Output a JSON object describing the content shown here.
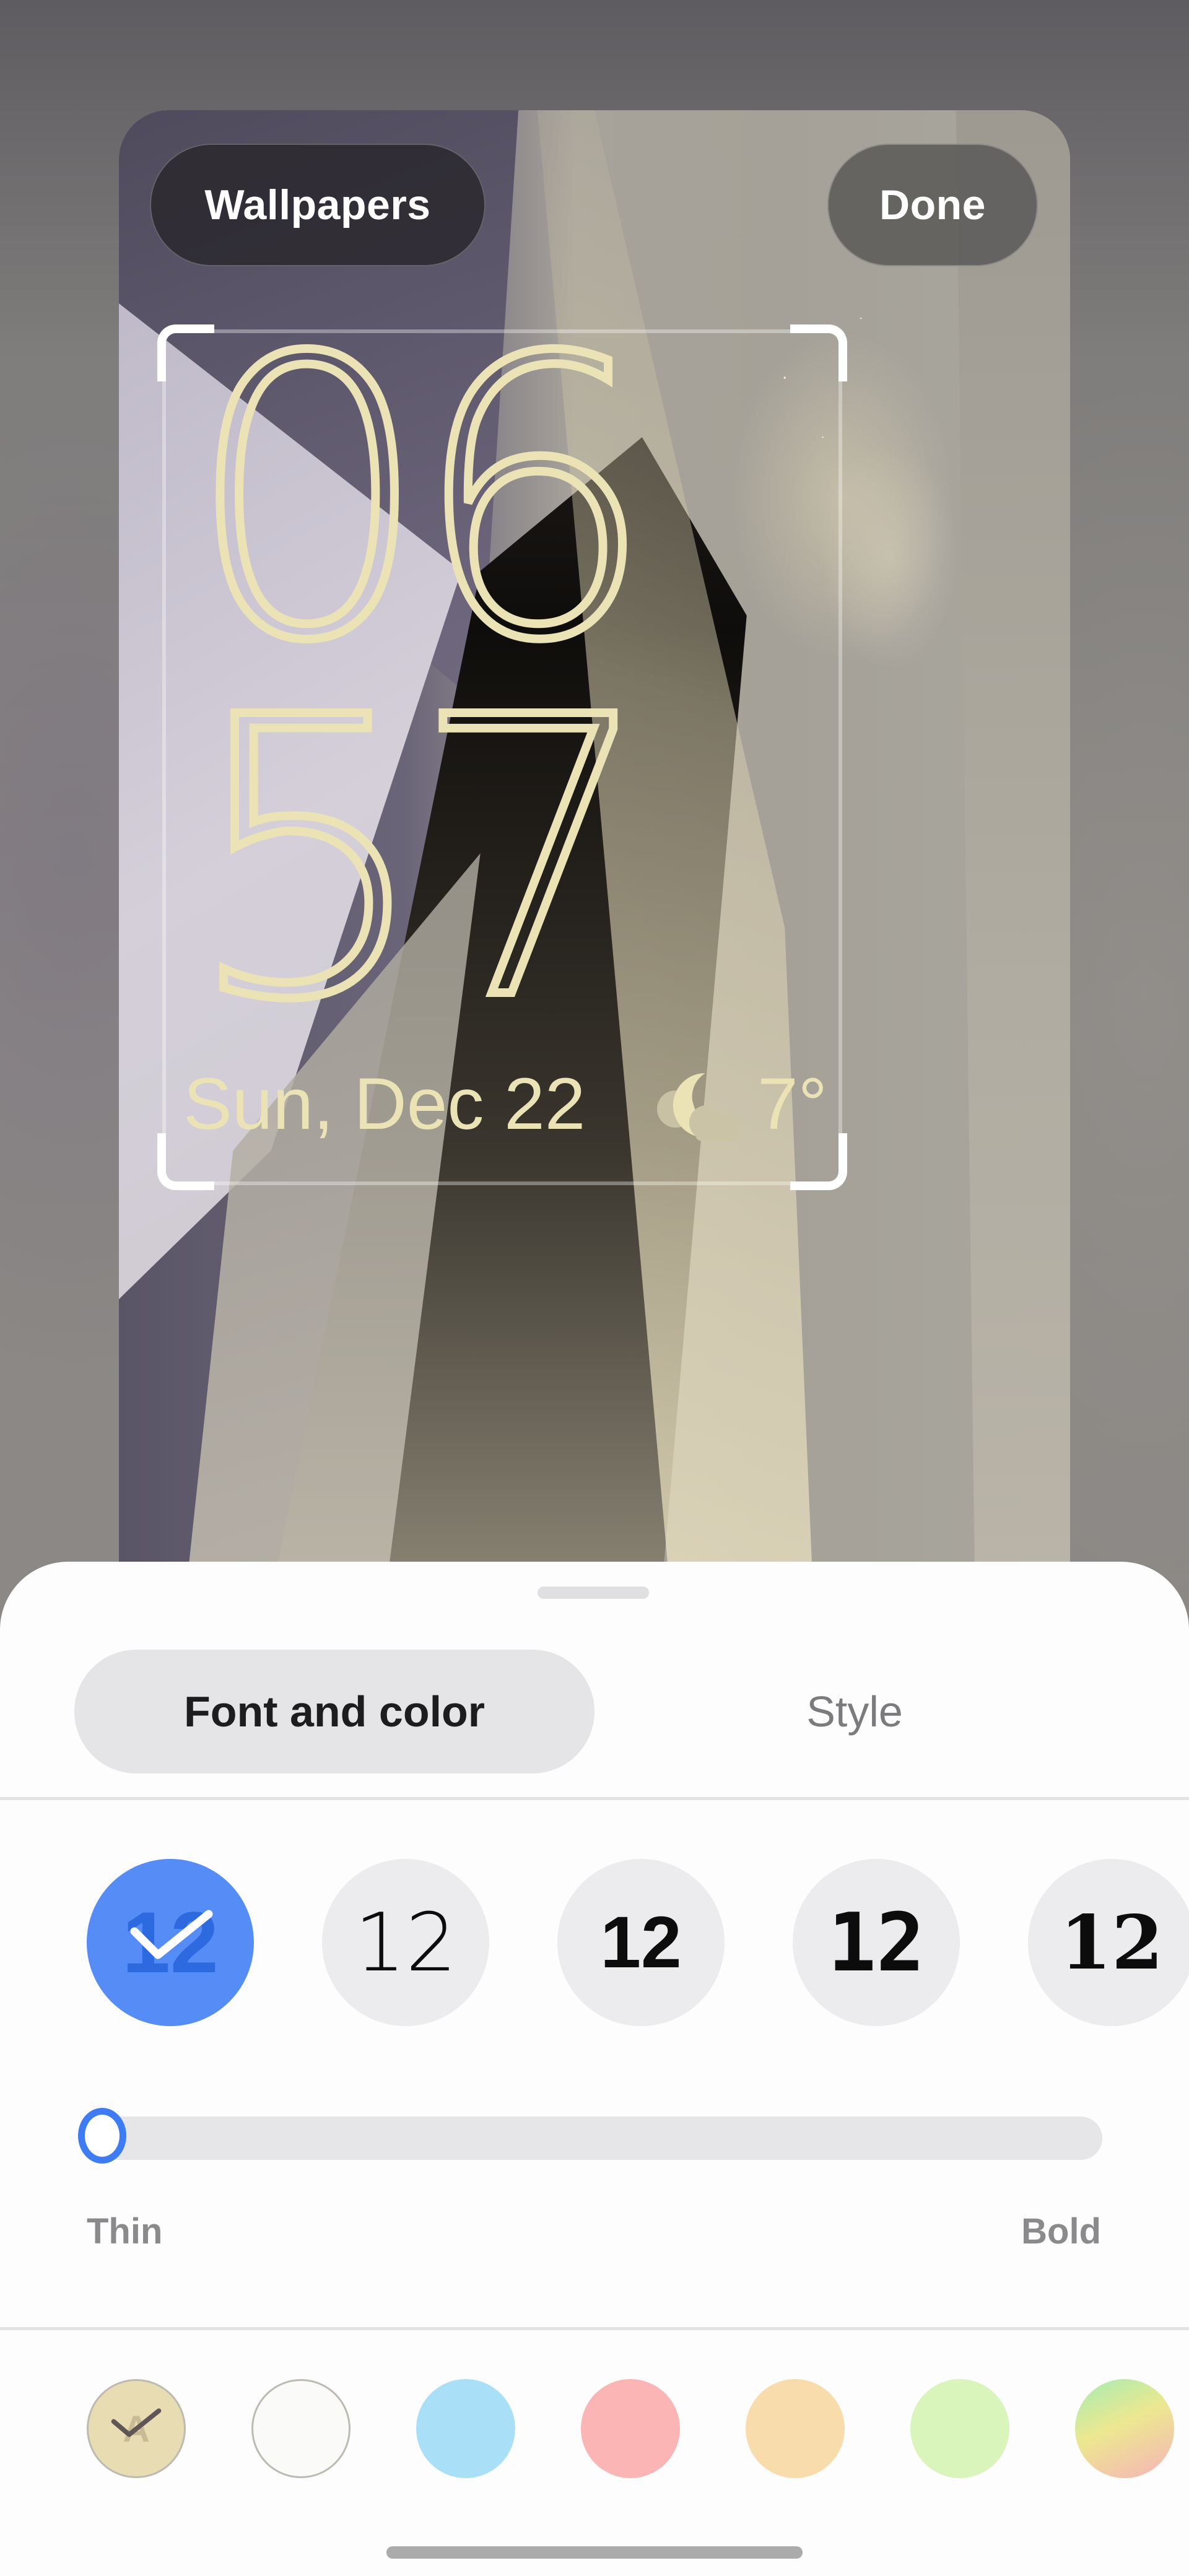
{
  "topbar": {
    "wallpapers_label": "Wallpapers",
    "done_label": "Done"
  },
  "lockscreen_preview": {
    "clock": {
      "hours": "06",
      "minutes": "57"
    },
    "date": "Sun, Dec 22",
    "weather": {
      "icon": "moon-cloud-icon",
      "temperature": "7°"
    },
    "clock_color": "#ebe2b5"
  },
  "sheet": {
    "tabs": [
      {
        "label": "Font and color",
        "selected": true
      },
      {
        "label": "Style",
        "selected": false
      }
    ],
    "font_options": [
      {
        "sample": "12",
        "selected": true
      },
      {
        "sample": "12",
        "selected": false
      },
      {
        "sample": "12",
        "selected": false
      },
      {
        "sample": "12",
        "selected": false
      },
      {
        "sample": "12",
        "selected": false
      }
    ],
    "weight_slider": {
      "min_label": "Thin",
      "max_label": "Bold",
      "value_fraction": 0.0
    },
    "color_options": [
      {
        "color": "#e7dcb2",
        "selected": true,
        "glyph": "A"
      },
      {
        "color": "#fafaf9",
        "selected": false
      },
      {
        "color": "#a9e0f8",
        "selected": false
      },
      {
        "color": "#fbb5b5",
        "selected": false
      },
      {
        "color": "#f9dcab",
        "selected": false
      },
      {
        "color": "#d9f5bc",
        "selected": false
      },
      {
        "color": "gradient-multicolor",
        "selected": false
      }
    ],
    "accent_color": "#558cf6"
  }
}
